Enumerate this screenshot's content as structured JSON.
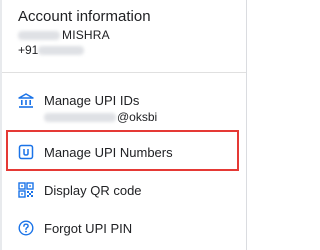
{
  "account": {
    "title": "Account information",
    "name_suffix": "MISHRA",
    "phone_prefix": "+91"
  },
  "menu": [
    {
      "label": "Manage UPI IDs",
      "sublabel": "@oksbi",
      "icon": "bank-icon"
    },
    {
      "label": "Manage UPI Numbers",
      "icon": "upi-number-icon"
    },
    {
      "label": "Display QR code",
      "icon": "qr-code-icon"
    },
    {
      "label": "Forgot UPI PIN",
      "icon": "help-circle-icon"
    }
  ],
  "colors": {
    "icon_blue": "#1a73e8",
    "highlight_red": "#e53935",
    "text": "#202124",
    "divider": "#e0e0e0"
  }
}
